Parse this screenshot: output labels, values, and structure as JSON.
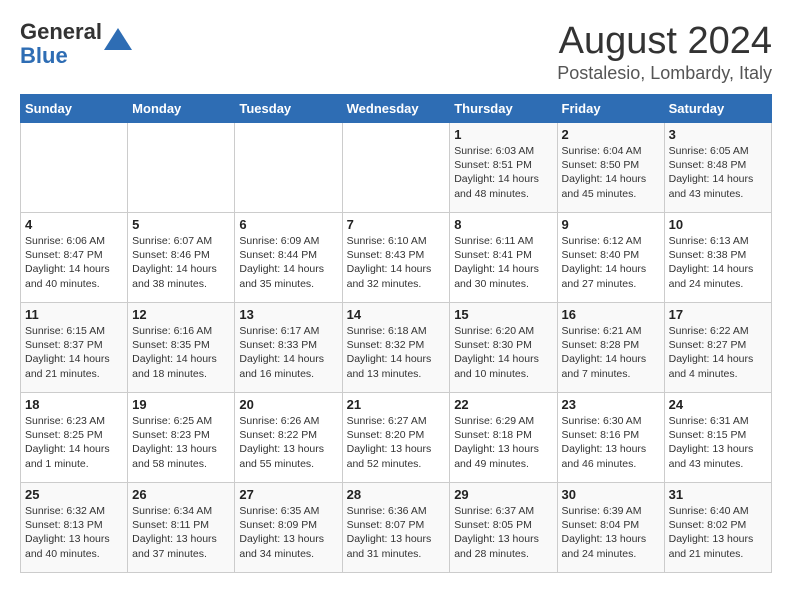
{
  "logo": {
    "line1": "General",
    "line2": "Blue"
  },
  "title": "August 2024",
  "subtitle": "Postalesio, Lombardy, Italy",
  "days_of_week": [
    "Sunday",
    "Monday",
    "Tuesday",
    "Wednesday",
    "Thursday",
    "Friday",
    "Saturday"
  ],
  "weeks": [
    [
      {
        "day": "",
        "info": ""
      },
      {
        "day": "",
        "info": ""
      },
      {
        "day": "",
        "info": ""
      },
      {
        "day": "",
        "info": ""
      },
      {
        "day": "1",
        "info": "Sunrise: 6:03 AM\nSunset: 8:51 PM\nDaylight: 14 hours\nand 48 minutes."
      },
      {
        "day": "2",
        "info": "Sunrise: 6:04 AM\nSunset: 8:50 PM\nDaylight: 14 hours\nand 45 minutes."
      },
      {
        "day": "3",
        "info": "Sunrise: 6:05 AM\nSunset: 8:48 PM\nDaylight: 14 hours\nand 43 minutes."
      }
    ],
    [
      {
        "day": "4",
        "info": "Sunrise: 6:06 AM\nSunset: 8:47 PM\nDaylight: 14 hours\nand 40 minutes."
      },
      {
        "day": "5",
        "info": "Sunrise: 6:07 AM\nSunset: 8:46 PM\nDaylight: 14 hours\nand 38 minutes."
      },
      {
        "day": "6",
        "info": "Sunrise: 6:09 AM\nSunset: 8:44 PM\nDaylight: 14 hours\nand 35 minutes."
      },
      {
        "day": "7",
        "info": "Sunrise: 6:10 AM\nSunset: 8:43 PM\nDaylight: 14 hours\nand 32 minutes."
      },
      {
        "day": "8",
        "info": "Sunrise: 6:11 AM\nSunset: 8:41 PM\nDaylight: 14 hours\nand 30 minutes."
      },
      {
        "day": "9",
        "info": "Sunrise: 6:12 AM\nSunset: 8:40 PM\nDaylight: 14 hours\nand 27 minutes."
      },
      {
        "day": "10",
        "info": "Sunrise: 6:13 AM\nSunset: 8:38 PM\nDaylight: 14 hours\nand 24 minutes."
      }
    ],
    [
      {
        "day": "11",
        "info": "Sunrise: 6:15 AM\nSunset: 8:37 PM\nDaylight: 14 hours\nand 21 minutes."
      },
      {
        "day": "12",
        "info": "Sunrise: 6:16 AM\nSunset: 8:35 PM\nDaylight: 14 hours\nand 18 minutes."
      },
      {
        "day": "13",
        "info": "Sunrise: 6:17 AM\nSunset: 8:33 PM\nDaylight: 14 hours\nand 16 minutes."
      },
      {
        "day": "14",
        "info": "Sunrise: 6:18 AM\nSunset: 8:32 PM\nDaylight: 14 hours\nand 13 minutes."
      },
      {
        "day": "15",
        "info": "Sunrise: 6:20 AM\nSunset: 8:30 PM\nDaylight: 14 hours\nand 10 minutes."
      },
      {
        "day": "16",
        "info": "Sunrise: 6:21 AM\nSunset: 8:28 PM\nDaylight: 14 hours\nand 7 minutes."
      },
      {
        "day": "17",
        "info": "Sunrise: 6:22 AM\nSunset: 8:27 PM\nDaylight: 14 hours\nand 4 minutes."
      }
    ],
    [
      {
        "day": "18",
        "info": "Sunrise: 6:23 AM\nSunset: 8:25 PM\nDaylight: 14 hours\nand 1 minute."
      },
      {
        "day": "19",
        "info": "Sunrise: 6:25 AM\nSunset: 8:23 PM\nDaylight: 13 hours\nand 58 minutes."
      },
      {
        "day": "20",
        "info": "Sunrise: 6:26 AM\nSunset: 8:22 PM\nDaylight: 13 hours\nand 55 minutes."
      },
      {
        "day": "21",
        "info": "Sunrise: 6:27 AM\nSunset: 8:20 PM\nDaylight: 13 hours\nand 52 minutes."
      },
      {
        "day": "22",
        "info": "Sunrise: 6:29 AM\nSunset: 8:18 PM\nDaylight: 13 hours\nand 49 minutes."
      },
      {
        "day": "23",
        "info": "Sunrise: 6:30 AM\nSunset: 8:16 PM\nDaylight: 13 hours\nand 46 minutes."
      },
      {
        "day": "24",
        "info": "Sunrise: 6:31 AM\nSunset: 8:15 PM\nDaylight: 13 hours\nand 43 minutes."
      }
    ],
    [
      {
        "day": "25",
        "info": "Sunrise: 6:32 AM\nSunset: 8:13 PM\nDaylight: 13 hours\nand 40 minutes."
      },
      {
        "day": "26",
        "info": "Sunrise: 6:34 AM\nSunset: 8:11 PM\nDaylight: 13 hours\nand 37 minutes."
      },
      {
        "day": "27",
        "info": "Sunrise: 6:35 AM\nSunset: 8:09 PM\nDaylight: 13 hours\nand 34 minutes."
      },
      {
        "day": "28",
        "info": "Sunrise: 6:36 AM\nSunset: 8:07 PM\nDaylight: 13 hours\nand 31 minutes."
      },
      {
        "day": "29",
        "info": "Sunrise: 6:37 AM\nSunset: 8:05 PM\nDaylight: 13 hours\nand 28 minutes."
      },
      {
        "day": "30",
        "info": "Sunrise: 6:39 AM\nSunset: 8:04 PM\nDaylight: 13 hours\nand 24 minutes."
      },
      {
        "day": "31",
        "info": "Sunrise: 6:40 AM\nSunset: 8:02 PM\nDaylight: 13 hours\nand 21 minutes."
      }
    ]
  ]
}
